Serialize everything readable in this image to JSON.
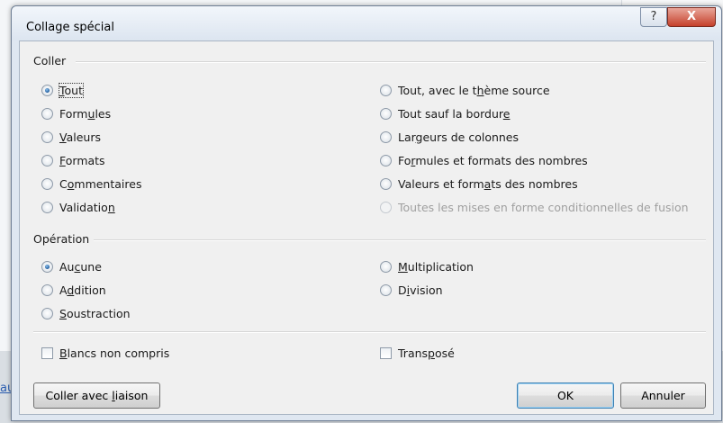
{
  "background": {
    "link_text": "au"
  },
  "dialog": {
    "title": "Collage spécial",
    "help_label": "?",
    "close_label": "X"
  },
  "paste_group": {
    "label": "Coller",
    "selected": "Tout",
    "left_options": [
      {
        "pre": "",
        "u": "T",
        "post": "out"
      },
      {
        "pre": "Form",
        "u": "u",
        "post": "les"
      },
      {
        "pre": "",
        "u": "V",
        "post": "aleurs"
      },
      {
        "pre": "",
        "u": "F",
        "post": "ormats"
      },
      {
        "pre": "C",
        "u": "o",
        "post": "mmentaires"
      },
      {
        "pre": "Validatio",
        "u": "n",
        "post": ""
      }
    ],
    "right_options": [
      {
        "pre": "Tout, avec le t",
        "u": "h",
        "post": "ème source"
      },
      {
        "pre": "Tout sauf la bordur",
        "u": "e",
        "post": ""
      },
      {
        "pre": "Lar",
        "u": "g",
        "post": "eurs de colonnes"
      },
      {
        "pre": "Fo",
        "u": "r",
        "post": "mules et formats des nombres"
      },
      {
        "pre": "Valeurs et form",
        "u": "a",
        "post": "ts des nombres"
      },
      {
        "pre": "Toutes les mises en forme conditionnelles de fusion",
        "u": "",
        "post": ""
      }
    ]
  },
  "operation_group": {
    "label": "Opération",
    "selected": "Aucune",
    "left_options": [
      {
        "pre": "Au",
        "u": "c",
        "post": "une"
      },
      {
        "pre": "A",
        "u": "d",
        "post": "dition"
      },
      {
        "pre": "",
        "u": "S",
        "post": "oustraction"
      }
    ],
    "right_options": [
      {
        "pre": "",
        "u": "M",
        "post": "ultiplication"
      },
      {
        "pre": "D",
        "u": "i",
        "post": "vision"
      }
    ]
  },
  "checkboxes": {
    "skip_blanks": {
      "pre": "",
      "u": "B",
      "post": "lancs non compris",
      "checked": false
    },
    "transpose": {
      "pre": "Trans",
      "u": "p",
      "post": "osé",
      "checked": false
    }
  },
  "buttons": {
    "paste_link": {
      "pre": "Coller avec ",
      "u": "l",
      "post": "iaison"
    },
    "ok": "OK",
    "cancel": "Annuler"
  }
}
